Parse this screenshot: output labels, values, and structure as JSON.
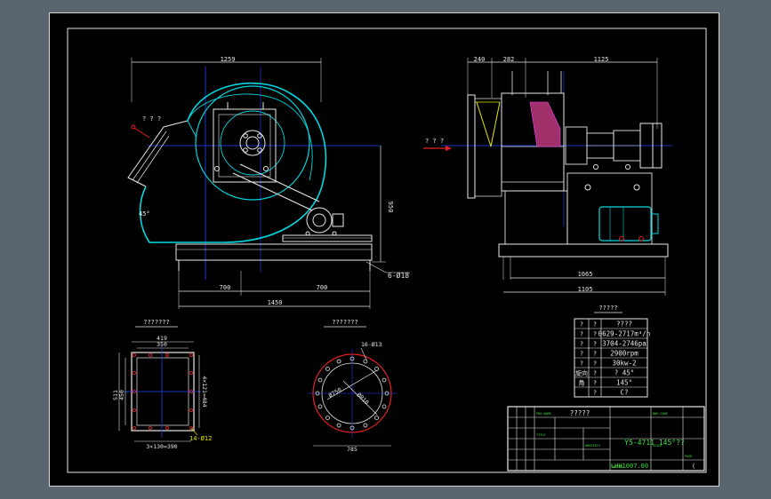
{
  "drawing": {
    "front_view": {
      "dim_width": "1259",
      "dim_height": "950",
      "dim_left_base": "700",
      "dim_right_base": "700",
      "dim_total_base": "1450",
      "bolt_holes": "6-Ø18",
      "angle": "45°",
      "outlet_label": "? ? ?"
    },
    "side_view": {
      "dim_a": "240",
      "dim_b": "282",
      "dim_c": "1125",
      "dim_base_1": "1065",
      "dim_base_2": "1105",
      "inlet_label": "? ? ?"
    },
    "outlet_flange": {
      "title": "???????",
      "dim_outer": "419",
      "dim_inner": "350",
      "dim_left_outer": "511",
      "dim_left_inner": "450",
      "dim_right": "4×121=484",
      "dim_bottom": "3×130=390",
      "holes": "14-Ø12"
    },
    "inlet_flange": {
      "title": "???????",
      "holes": "16-Ø13",
      "pcd_1": "Ø750",
      "pcd_2": "Ø810",
      "dim_bottom": "785"
    },
    "spec_table": {
      "title": "?????",
      "rows": [
        [
          "?",
          "?",
          "????"
        ],
        [
          "?",
          "?",
          "0629-2717m³/h"
        ],
        [
          "?",
          "?",
          "3704-2746pa"
        ],
        [
          "?",
          "?",
          "2900rpm"
        ],
        [
          "?",
          "?",
          "30kw-2"
        ],
        [
          "旋向",
          "?",
          "? 45°"
        ],
        [
          "角",
          "?",
          "145°"
        ],
        [
          "",
          "?",
          "C?"
        ]
      ]
    },
    "title_block": {
      "company": "?????",
      "drawing_name": "Y5-4711 145°??",
      "drawing_number": "LHH1007.00",
      "small_1": "PRO NAME",
      "small_2": "DWG CODE",
      "small_3": "TITLE",
      "small_4": "ARKSTATS",
      "small_5": "SCALE",
      "small_6": "PAGE",
      "small_7": "DWG NO"
    }
  },
  "colors": {
    "sheet_bg": "#000000",
    "frame": "#d9d9d9",
    "cyan": "#00d8e0",
    "blue": "#2244ff",
    "red": "#e82020",
    "yellow": "#e8e800",
    "green": "#40e040",
    "white": "#e8e8e8",
    "magenta": "#ff40ff"
  }
}
